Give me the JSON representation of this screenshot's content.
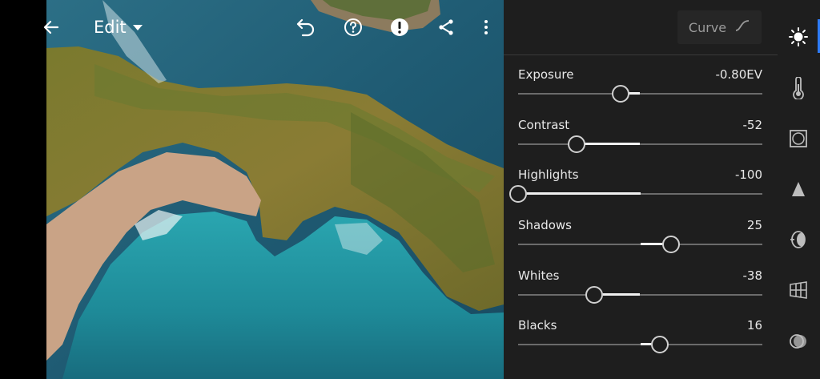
{
  "header": {
    "edit_label": "Edit",
    "icons": [
      "back-arrow-icon",
      "undo-icon",
      "help-icon",
      "alert-icon",
      "share-icon",
      "more-vertical-icon"
    ]
  },
  "panel": {
    "curve_label": "Curve",
    "sliders": [
      {
        "label": "Exposure",
        "value": "-0.80EV",
        "level": 0.42
      },
      {
        "label": "Contrast",
        "value": "-52",
        "level": 0.24
      },
      {
        "label": "Highlights",
        "value": "-100",
        "level": 0.0
      },
      {
        "label": "Shadows",
        "value": "25",
        "level": 0.625
      },
      {
        "label": "Whites",
        "value": "-38",
        "level": 0.31
      },
      {
        "label": "Blacks",
        "value": "16",
        "level": 0.58
      }
    ]
  },
  "toolrail": {
    "items": [
      "light-icon",
      "color-temperature-icon",
      "effects-vignette-icon",
      "detail-icon",
      "optics-icon",
      "geometry-icon",
      "presets-icon"
    ],
    "active": "light-icon",
    "accent_color": "#2d7bf6"
  }
}
